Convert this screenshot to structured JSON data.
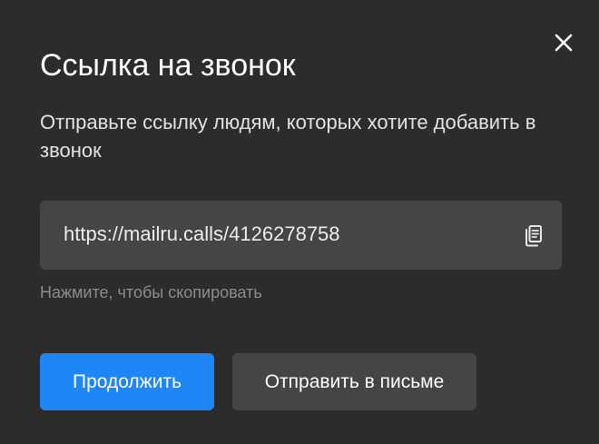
{
  "dialog": {
    "title": "Ссылка на звонок",
    "description": "Отправьте ссылку людям, которых хотите добавить в звонок",
    "link": "https://mailru.calls/4126278758",
    "hint": "Нажмите, чтобы скопировать",
    "icons": {
      "close": "close-icon",
      "copy": "copy-icon"
    }
  },
  "actions": {
    "continue_label": "Продолжить",
    "send_email_label": "Отправить в письме"
  },
  "colors": {
    "background": "#2c2c2c",
    "field": "#454545",
    "primary": "#1e86f5",
    "hint": "#8c8c8c"
  }
}
